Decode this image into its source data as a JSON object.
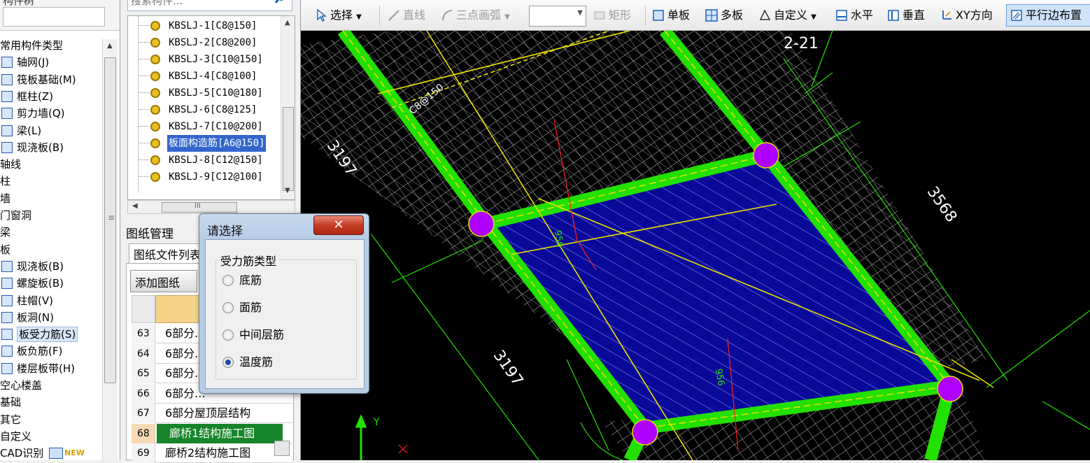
{
  "left_tree": {
    "top_partial": "构件树",
    "items": [
      {
        "label": "常用构件类型"
      },
      {
        "label": "轴网(J)"
      },
      {
        "label": "筏板基础(M)"
      },
      {
        "label": "框柱(Z)"
      },
      {
        "label": "剪力墙(Q)"
      },
      {
        "label": "梁(L)"
      },
      {
        "label": "现浇板(B)"
      },
      {
        "label": "轴线"
      },
      {
        "label": "柱"
      },
      {
        "label": "墙"
      },
      {
        "label": "门窗洞"
      },
      {
        "label": "梁"
      },
      {
        "label": "板"
      },
      {
        "label": "现浇板(B)"
      },
      {
        "label": "螺旋板(B)"
      },
      {
        "label": "柱帽(V)"
      },
      {
        "label": "板洞(N)"
      },
      {
        "label": "板受力筋(S)"
      },
      {
        "label": "板负筋(F)"
      },
      {
        "label": "楼层板带(H)"
      },
      {
        "label": "空心楼盖"
      },
      {
        "label": "基础"
      },
      {
        "label": "其它"
      },
      {
        "label": "自定义"
      },
      {
        "label": "CAD识别"
      }
    ],
    "new_badge": "NEW"
  },
  "component_panel": {
    "search_placeholder": "搜索构件...",
    "items": [
      {
        "label": "KBSLJ-1[C8@150]"
      },
      {
        "label": "KBSLJ-2[C8@200]"
      },
      {
        "label": "KBSLJ-3[C10@150]"
      },
      {
        "label": "KBSLJ-4[C8@100]"
      },
      {
        "label": "KBSLJ-5[C10@180]"
      },
      {
        "label": "KBSLJ-6[C8@125]"
      },
      {
        "label": "KBSLJ-7[C10@200]"
      },
      {
        "label": "板面构造筋[A6@150]"
      },
      {
        "label": "KBSLJ-8[C12@150]"
      },
      {
        "label": "KBSLJ-9[C12@100]"
      }
    ],
    "hscroll_grip": "III"
  },
  "drawing_manager": {
    "title": "图纸管理",
    "tab": "图纸文件列表",
    "add_button": "添加图纸",
    "rows": [
      {
        "no": "63",
        "name": "6部分..."
      },
      {
        "no": "64",
        "name": "6部分..."
      },
      {
        "no": "65",
        "name": "6部分..."
      },
      {
        "no": "66",
        "name": "6部分..."
      },
      {
        "no": "67",
        "name": "6部分屋顶层结构"
      },
      {
        "no": "68",
        "name": "廊桥1结构施工图"
      },
      {
        "no": "69",
        "name": "廊桥2结构施工图"
      }
    ]
  },
  "dialog": {
    "title": "请选择",
    "close": "✕",
    "group_title": "受力筋类型",
    "options": [
      {
        "label": "底筋",
        "checked": false
      },
      {
        "label": "面筋",
        "checked": false
      },
      {
        "label": "中间层筋",
        "checked": false
      },
      {
        "label": "温度筋",
        "checked": true
      }
    ]
  },
  "toolbar": {
    "select": "选择",
    "line": "直线",
    "arc": "三点画弧",
    "rect": "矩形",
    "single": "单板",
    "multi": "多板",
    "custom": "自定义",
    "horizontal": "水平",
    "vertical": "垂直",
    "xy": "XY方向",
    "parallel": "平行边布置"
  },
  "canvas": {
    "labels": {
      "axis_id": "2-21",
      "dim_a": "3197",
      "dim_b": "3568",
      "dim_c": "3197",
      "rebar_tag": "C8@150",
      "y_axis": "Y",
      "small_a": "956",
      "small_b": "956"
    },
    "colors": {
      "background": "#000000",
      "beam_green": "#22e000",
      "slab_fill": "#0a0a9a",
      "yellow": "#e8e000",
      "column": "#b000ff",
      "red": "#ff2020"
    }
  }
}
